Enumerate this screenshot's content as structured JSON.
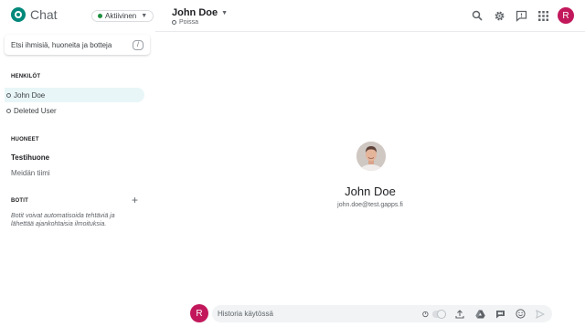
{
  "app": {
    "name": "Chat"
  },
  "status": {
    "label": "Aktiivinen"
  },
  "conversation": {
    "title": "John Doe",
    "subtitle": "Poissa"
  },
  "header": {
    "avatar_letter": "R"
  },
  "search": {
    "placeholder": "Etsi ihmisiä, huoneita ja botteja",
    "shortcut": "/"
  },
  "sidebar": {
    "people_heading": "HENKILÖT",
    "people": [
      {
        "label": "John Doe"
      },
      {
        "label": "Deleted User"
      }
    ],
    "rooms_heading": "HUONEET",
    "rooms": [
      {
        "label": "Testihuone"
      },
      {
        "label": "Meidän tiimi"
      }
    ],
    "bots_heading": "BOTIT",
    "bots_info": "Botit voivat automatisoida tehtäviä ja lähettää ajankohtaisia ilmoituksia."
  },
  "profile": {
    "name": "John Doe",
    "email": "john.doe@test.gapps.fi"
  },
  "composer": {
    "avatar_letter": "R",
    "placeholder": "Historia käytössä"
  },
  "colors": {
    "accent": "#00897b",
    "avatar": "#c2185b",
    "active_item": "#e8f6f8",
    "online": "#1e8e3e"
  }
}
